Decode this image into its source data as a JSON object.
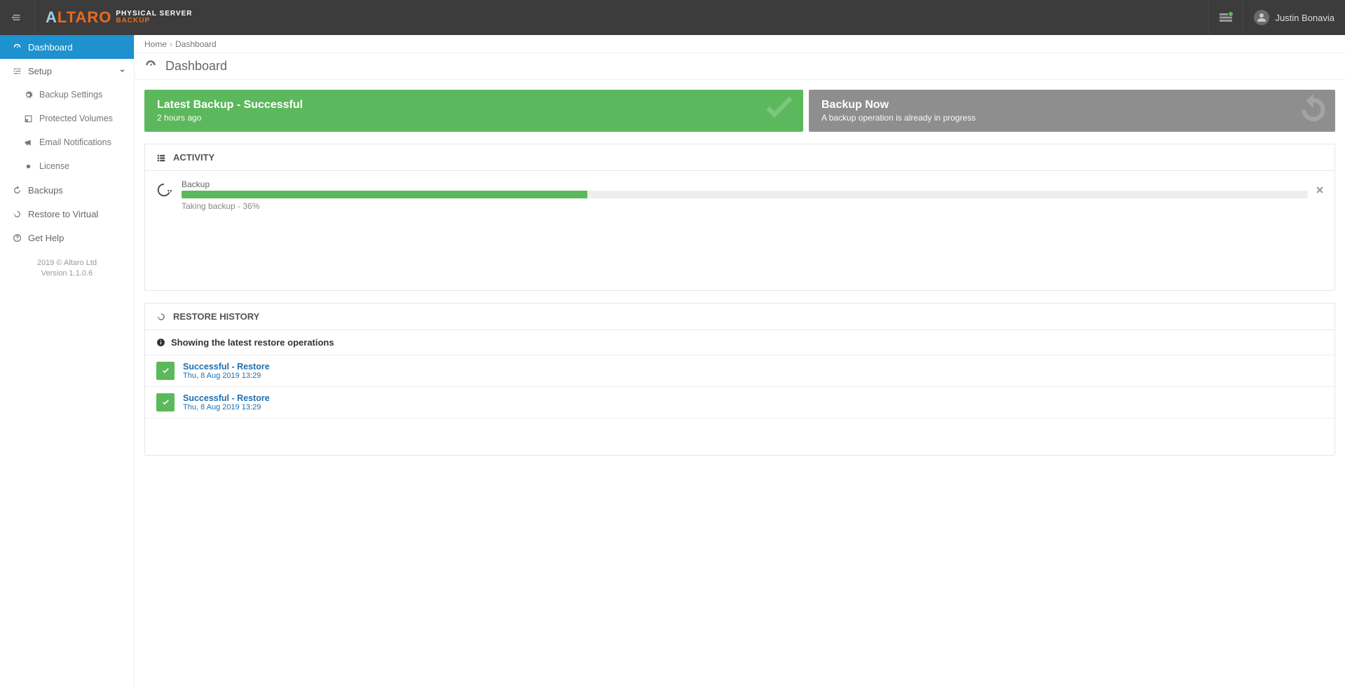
{
  "header": {
    "brand_main": "ALTARO",
    "brand_sub1": "PHYSICAL SERVER",
    "brand_sub2": "BACKUP",
    "user_name": "Justin Bonavia"
  },
  "sidebar": {
    "items": [
      {
        "label": "Dashboard"
      },
      {
        "label": "Setup"
      },
      {
        "label": "Backup Settings"
      },
      {
        "label": "Protected Volumes"
      },
      {
        "label": "Email Notifications"
      },
      {
        "label": "License"
      },
      {
        "label": "Backups"
      },
      {
        "label": "Restore to Virtual"
      },
      {
        "label": "Get Help"
      }
    ],
    "footer": {
      "copyright": "2019 © Altaro Ltd",
      "version": "Version 1.1.0.6"
    }
  },
  "breadcrumb": {
    "home": "Home",
    "current": "Dashboard"
  },
  "page_title": "Dashboard",
  "cards": {
    "latest": {
      "title": "Latest Backup - Successful",
      "subtitle": "2 hours ago"
    },
    "backup_now": {
      "title": "Backup Now",
      "subtitle": "A backup operation is already in progress"
    }
  },
  "activity": {
    "heading": "ACTIVITY",
    "row": {
      "label": "Backup",
      "percent": 36,
      "status_text": "Taking backup - 36%"
    }
  },
  "restore": {
    "heading": "RESTORE HISTORY",
    "info": "Showing the latest restore operations",
    "items": [
      {
        "title": "Successful - Restore",
        "when": "Thu, 8 Aug 2019 13:29"
      },
      {
        "title": "Successful - Restore",
        "when": "Thu, 8 Aug 2019 13:29"
      }
    ]
  }
}
